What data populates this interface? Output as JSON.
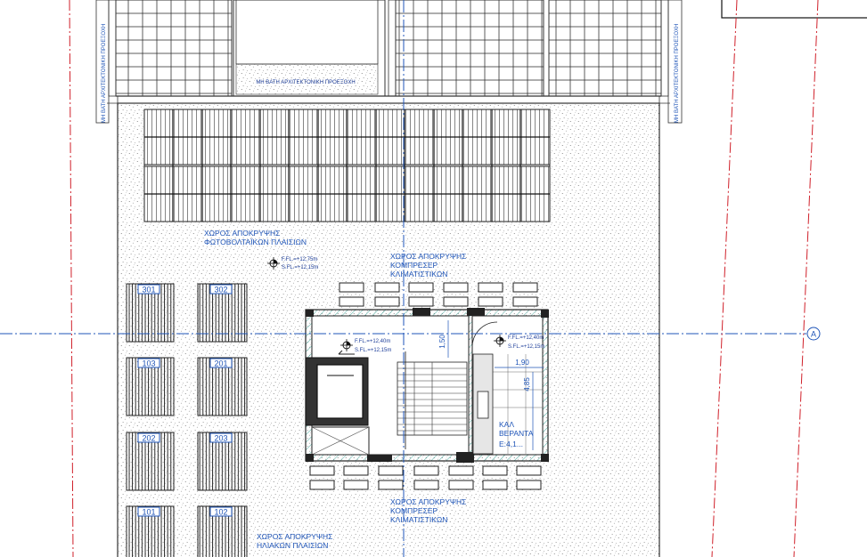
{
  "labels": {
    "architectural_projection": "ΜΗ ΒΑΤΗ ΑΡΧΙΤΕΚΤΟΝΙΚΗ ΠΡΟΕΞΟΧΗ",
    "side_projection_left": "ΜΗ ΒΑΤΗ ΑΡΧΙΤΕΚΤΟΝΙΚΗ ΠΡΟΕΞΟΧΗ",
    "side_projection_right": "ΜΗ ΒΑΤΗ ΑΡΧΙΤΕΚΤΟΝΙΚΗ ΠΡΟΕΞΟΧΗ",
    "pv_area_line1": "ΧΩΡΟΣ ΑΠΟΚΡΥΨΗΣ",
    "pv_area_line2": "ΦΩΤΟΒΟΛΤΑΪΚΩΝ ΠΛΑΙΣΙΩΝ",
    "comp_top_line1": "ΧΩΡΟΣ ΑΠΟΚΡΥΨΗΣ",
    "comp_top_line2": "ΚΟΜΠΡΕΣΕΡ",
    "comp_top_line3": "ΚΛΙΜΑΤΙΣΤΙΚΩΝ",
    "comp_bottom_line1": "ΧΩΡΟΣ ΑΠΟΚΡΥΨΗΣ",
    "comp_bottom_line2": "ΚΟΜΠΡΕΣΕΡ",
    "comp_bottom_line3": "ΚΛΙΜΑΤΙΣΤΙΚΩΝ",
    "solar_area_line1": "ΧΩΡΟΣ ΑΠΟΚΡΥΨΗΣ",
    "solar_area_line2": "ΗΛΙΑΚΩΝ ΠΛΑΙΣΙΩΝ",
    "veranda_line1": "ΚΑΛ",
    "veranda_line2": "ΒΕΡΑΝΤΑ",
    "veranda_line3": "Ε:4,1..."
  },
  "levels": {
    "roof_ffl": "F.FL.=+12,75m",
    "roof_sfl": "S.FL.=+12,15m",
    "stair_ffl": "F.FL.=+12,40m",
    "stair_sfl": "S.FL.=+12,15m",
    "veranda_ffl": "F.FL.=+12,40m",
    "veranda_sfl": "S.FL.=+12,15m"
  },
  "dimensions": {
    "stair_width": "1,50",
    "veranda_width": "1,90",
    "veranda_depth": "4,85"
  },
  "axis": {
    "grid_label": "A"
  },
  "heaters": [
    {
      "id": "301"
    },
    {
      "id": "302"
    },
    {
      "id": "103"
    },
    {
      "id": "201"
    },
    {
      "id": "202"
    },
    {
      "id": "203"
    },
    {
      "id": "101"
    },
    {
      "id": "102"
    }
  ],
  "colors": {
    "annotation": "#1f55b8",
    "property_line": "#d0202a",
    "lines": "#222222",
    "hatch": "#2a9d8f"
  }
}
